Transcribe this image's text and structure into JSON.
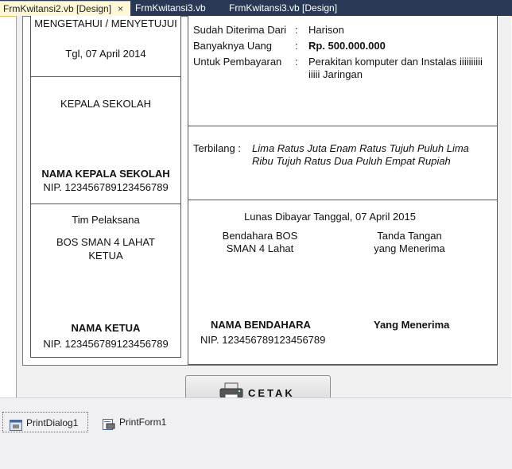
{
  "tabs": [
    {
      "label": "FrmKwitansi2.vb [Design]",
      "active": true
    },
    {
      "label": "FrmKwitansi3.vb",
      "active": false
    },
    {
      "label": "FrmKwitansi3.vb [Design]",
      "active": false
    }
  ],
  "close_glyph": "×",
  "left": {
    "mengetahui": "MENGETAHUI / MENYETUJUI",
    "tanggal": "Tgl, 07 April 2014",
    "kepala_title": "KEPALA SEKOLAH",
    "kepala_name": "NAMA KEPALA SEKOLAH",
    "kepala_nip": "NIP. 123456789123456789",
    "tim": "Tim Pelaksana",
    "bos_line1": "BOS SMAN 4 LAHAT",
    "bos_line2": "KETUA",
    "ketua_name": "NAMA KETUA",
    "ketua_nip": "NIP. 123456789123456789"
  },
  "receipt": {
    "row1_label": "Sudah Diterima Dari",
    "row1_value": "Harison",
    "row2_label": "Banyaknya Uang",
    "row2_value": "Rp. 500.000.000",
    "row3_label": "Untuk Pembayaran",
    "row3_value_line1": "Perakitan komputer dan Instalas iiiiiiiiii",
    "row3_value_line2": "iiiii Jaringan",
    "colon": ":",
    "terbilang_label": "Terbilang :",
    "terbilang_line1": "Lima Ratus Juta Enam Ratus Tujuh Puluh Lima",
    "terbilang_line2": "Ribu Tujuh Ratus Dua Puluh Empat Rupiah",
    "lunas": "Lunas Dibayar Tanggal, 07 April 2015",
    "bendahara_line1": "Bendahara BOS",
    "bendahara_line2": "SMAN 4 Lahat",
    "tanda_line1": "Tanda Tangan",
    "tanda_line2": "yang Menerima",
    "bendahara_name": "NAMA BENDAHARA",
    "bendahara_nip": "NIP.  123456789123456789",
    "penerima_name": "Yang Menerima"
  },
  "cetak_label": "CETAK",
  "tray": [
    {
      "label": "PrintDialog1",
      "icon": "print-dialog-icon"
    },
    {
      "label": "PrintForm1",
      "icon": "print-form-icon"
    }
  ]
}
